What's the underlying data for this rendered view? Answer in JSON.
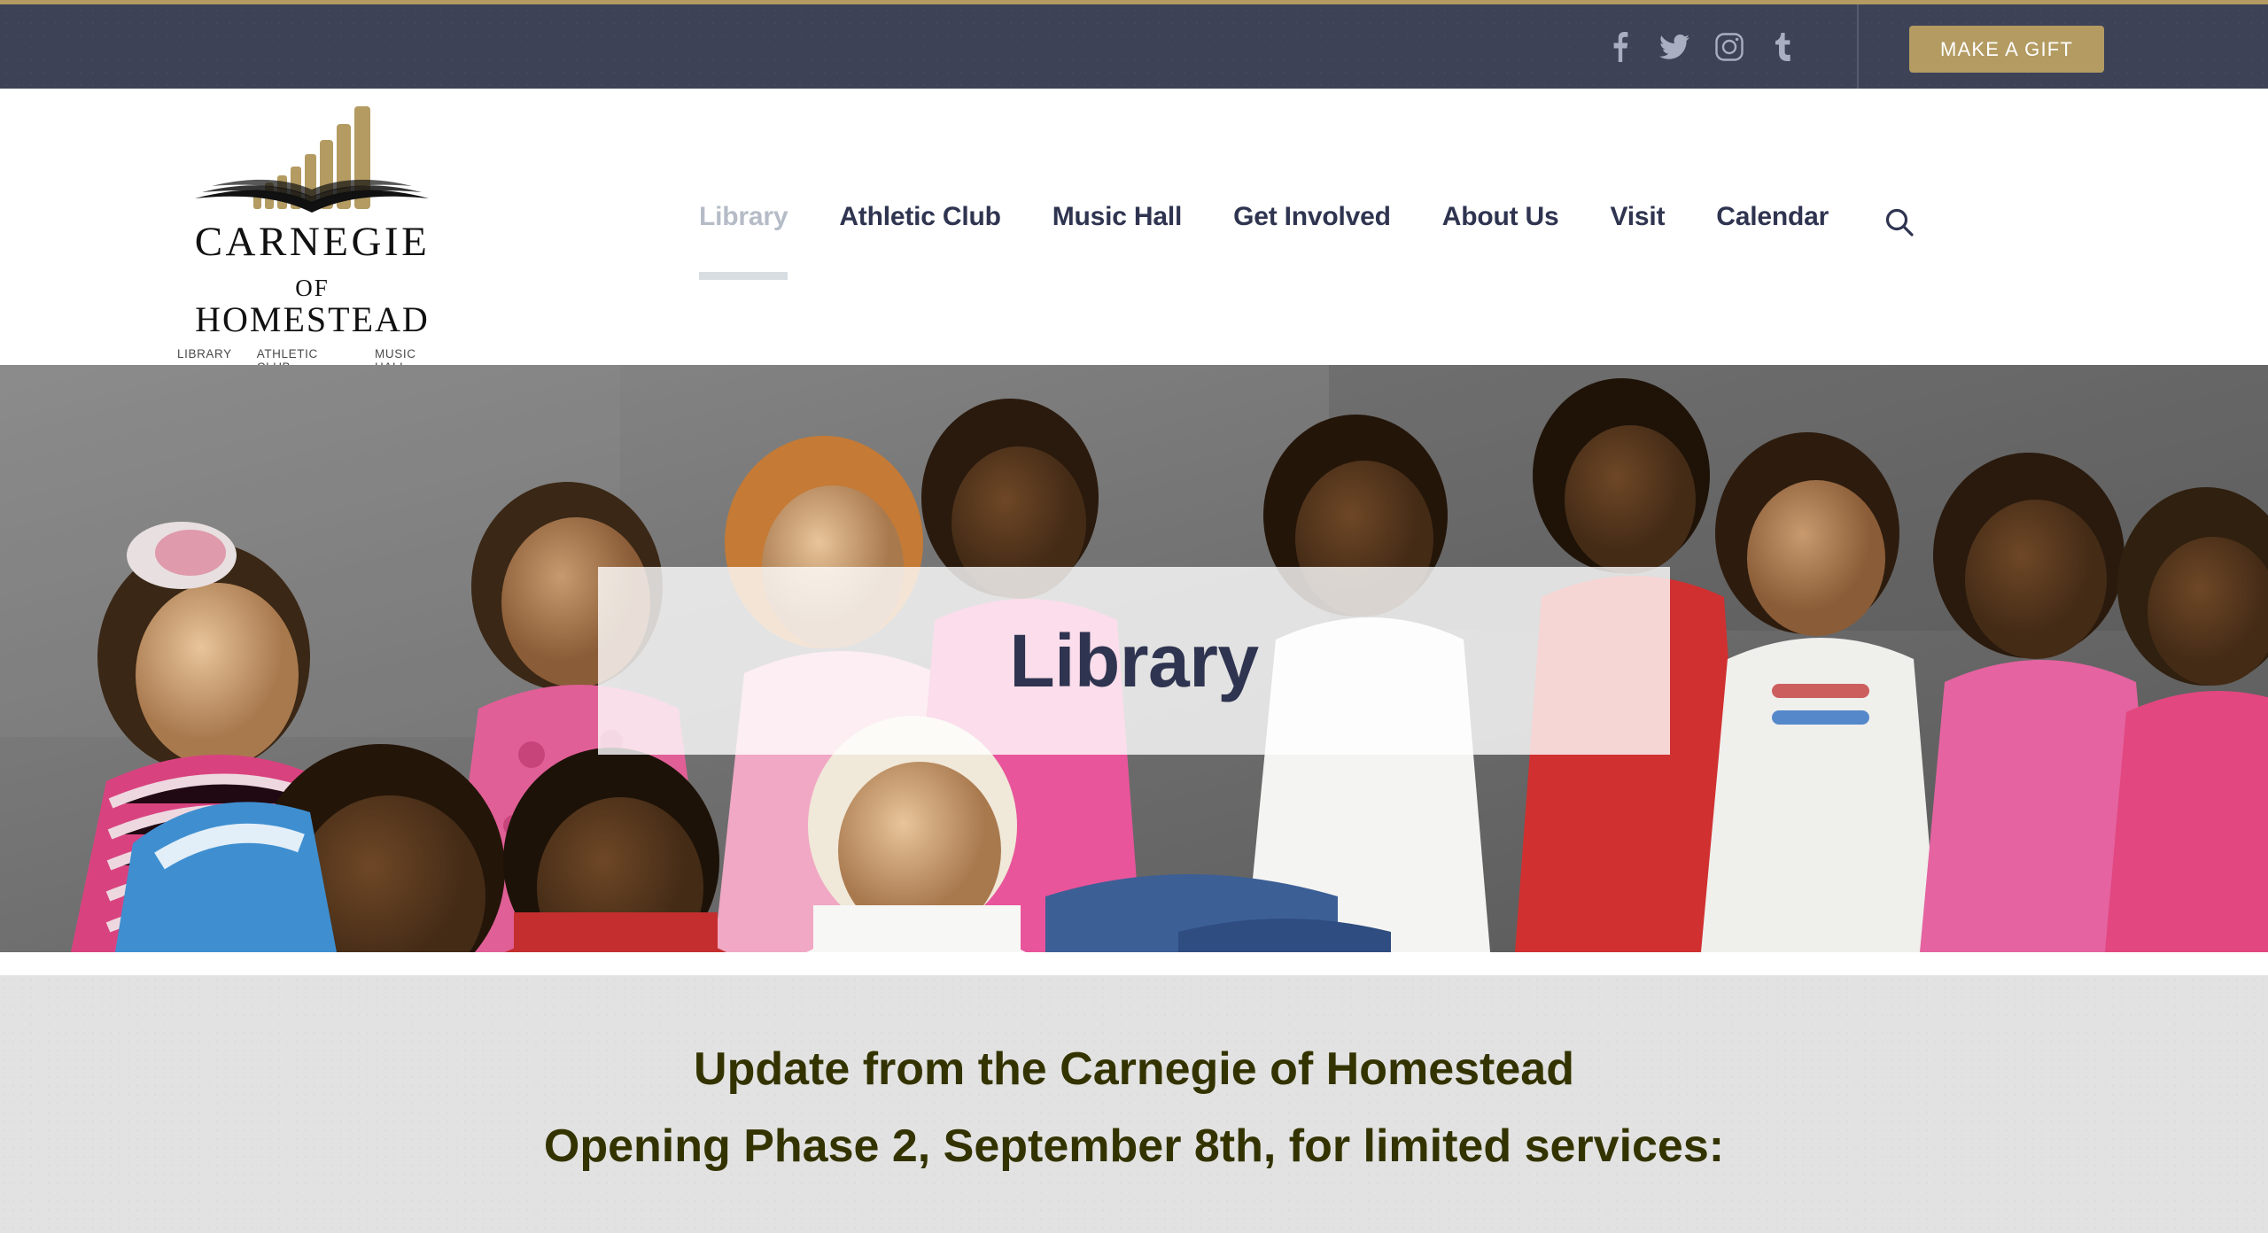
{
  "brand": {
    "accent_gold": "#b39b62",
    "navy": "#3d4257",
    "title_navy": "#2f3450",
    "announcement_color": "#333300",
    "logo_line1": "CARNEGIE",
    "logo_line2_of": "OF",
    "logo_line2_main": "HOMESTEAD",
    "tagline": [
      "LIBRARY",
      "ATHLETIC CLUB",
      "MUSIC HALL"
    ]
  },
  "utility_bar": {
    "social": [
      {
        "name": "facebook-icon",
        "label": "Facebook"
      },
      {
        "name": "twitter-icon",
        "label": "Twitter"
      },
      {
        "name": "instagram-icon",
        "label": "Instagram"
      },
      {
        "name": "tumblr-icon",
        "label": "Tumblr"
      }
    ],
    "gift_label": "MAKE A GIFT"
  },
  "nav": {
    "items": [
      {
        "label": "Library",
        "active": true
      },
      {
        "label": "Athletic Club",
        "active": false
      },
      {
        "label": "Music Hall",
        "active": false
      },
      {
        "label": "Get Involved",
        "active": false
      },
      {
        "label": "About Us",
        "active": false
      },
      {
        "label": "Visit",
        "active": false
      },
      {
        "label": "Calendar",
        "active": false
      }
    ],
    "search_icon": "search-icon"
  },
  "hero": {
    "title": "Library",
    "image_description": "Group of smiling children sitting on grey pavement"
  },
  "announcement": {
    "line1": "Update from the Carnegie of Homestead",
    "line2": "Opening Phase 2, September 8th, for limited services:"
  }
}
